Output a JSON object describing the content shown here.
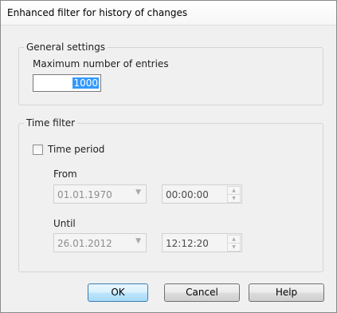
{
  "window": {
    "title": "Enhanced filter for history of changes"
  },
  "general": {
    "legend": "General settings",
    "max_entries_label": "Maximum number of entries",
    "max_entries_value": "1000"
  },
  "time_filter": {
    "legend": "Time filter",
    "time_period_label": "Time period",
    "time_period_checked": false,
    "from_label": "From",
    "from_date": "01.01.1970",
    "from_time": "00:00:00",
    "until_label": "Until",
    "until_date": "26.01.2012",
    "until_time": "12:12:20"
  },
  "buttons": {
    "ok": "OK",
    "cancel": "Cancel",
    "help": "Help"
  }
}
